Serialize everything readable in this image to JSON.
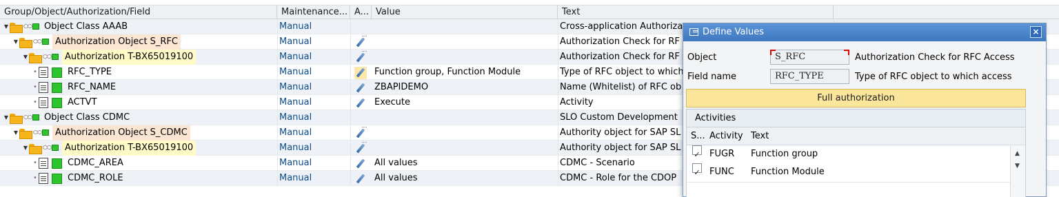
{
  "columns": {
    "name": "Group/Object/Authorization/Field",
    "maint": "Maintenance...",
    "a": "A...",
    "value": "Value",
    "text": "Text"
  },
  "rows": [
    {
      "indent": 0,
      "kind": "class",
      "name": "Object Class AAAB",
      "maint": "Manual",
      "icon": "none",
      "value": "",
      "text": "Cross-application Authoriza"
    },
    {
      "indent": 1,
      "kind": "object",
      "name": "Authorization Object S_RFC",
      "maint": "Manual",
      "icon": "pencil-faint",
      "value": "",
      "text": "Authorization Check for RF"
    },
    {
      "indent": 2,
      "kind": "auth",
      "name": "Authorization T-BX65019100",
      "maint": "Manual",
      "icon": "pencil-faint",
      "value": "",
      "text": "Authorization Check for RF"
    },
    {
      "indent": 3,
      "kind": "field",
      "name": "RFC_TYPE",
      "maint": "Manual",
      "icon": "pencil-hl",
      "value": "Function group, Function Module",
      "text": "Type of RFC object to which"
    },
    {
      "indent": 3,
      "kind": "field",
      "name": "RFC_NAME",
      "maint": "Manual",
      "icon": "pencil",
      "value": "ZBAPIDEMO",
      "text": "Name (Whitelist) of RFC ob"
    },
    {
      "indent": 3,
      "kind": "field",
      "name": "ACTVT",
      "maint": "Manual",
      "icon": "pencil",
      "value": "Execute",
      "text": "Activity"
    },
    {
      "indent": 0,
      "kind": "class",
      "name": "Object Class CDMC",
      "maint": "Manual",
      "icon": "none",
      "value": "",
      "text": "SLO Custom Development"
    },
    {
      "indent": 1,
      "kind": "object",
      "name": "Authorization Object S_CDMC",
      "maint": "Manual",
      "icon": "pencil-faint",
      "value": "",
      "text": "Authority object for SAP SL"
    },
    {
      "indent": 2,
      "kind": "auth",
      "name": "Authorization T-BX65019100",
      "maint": "Manual",
      "icon": "pencil-faint",
      "value": "",
      "text": "Authority object for SAP SL"
    },
    {
      "indent": 3,
      "kind": "field",
      "name": "CDMC_AREA",
      "maint": "Manual",
      "icon": "pencil",
      "value": "All values",
      "text": "CDMC - Scenario"
    },
    {
      "indent": 3,
      "kind": "field",
      "name": "CDMC_ROLE",
      "maint": "Manual",
      "icon": "pencil",
      "value": "All values",
      "text": "CDMC - Role for the CDOP"
    }
  ],
  "dialog": {
    "title": "Define Values",
    "close": "×",
    "object_label": "Object",
    "object_value": "S_RFC",
    "object_desc": "Authorization Check for RFC Access",
    "field_label": "Field name",
    "field_value": "RFC_TYPE",
    "field_desc": "Type of RFC object to which access",
    "full_auth": "Full authorization",
    "activities_title": "Activities",
    "act_headers": {
      "s": "S...",
      "activity": "Activity",
      "text": "Text"
    },
    "activities": [
      {
        "checked": "✓",
        "code": "FUGR",
        "text": "Function group"
      },
      {
        "checked": "✓",
        "code": "FUNC",
        "text": "Function Module"
      }
    ]
  },
  "colors": {
    "header_bg": "#eef1f4",
    "alt_row": "#eef2f6",
    "object_highlight": "#fbe6d3",
    "auth_highlight": "#fffbc8",
    "dialog_title": "#3f78c0",
    "full_auth_button": "#fbe69c"
  }
}
